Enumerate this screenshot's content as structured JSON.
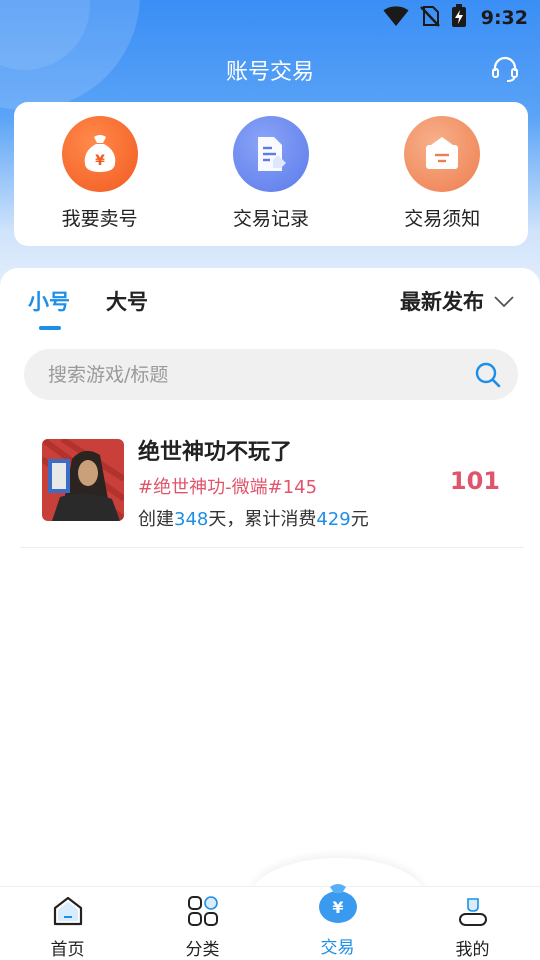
{
  "status_bar": {
    "time": "9:32"
  },
  "header": {
    "title": "账号交易"
  },
  "quick_actions": [
    {
      "label": "我要卖号",
      "icon": "money-bag-icon",
      "color": "#f5682f"
    },
    {
      "label": "交易记录",
      "icon": "document-edit-icon",
      "color": "#5b7bea"
    },
    {
      "label": "交易须知",
      "icon": "briefcase-icon",
      "color": "#f08a5d"
    }
  ],
  "tabs": [
    {
      "label": "小号",
      "active": true
    },
    {
      "label": "大号",
      "active": false
    }
  ],
  "sort": {
    "label": "最新发布"
  },
  "search": {
    "placeholder": "搜索游戏/标题"
  },
  "listings": [
    {
      "title": "绝世神功不玩了",
      "tag": "#绝世神功-微端#145",
      "stats_prefix": "创建",
      "days": "348",
      "stats_mid": "天，累计消费",
      "spent": "429",
      "stats_suffix": "元",
      "price": "101"
    }
  ],
  "bottom_nav": [
    {
      "label": "首页",
      "icon": "home-icon",
      "active": false
    },
    {
      "label": "分类",
      "icon": "category-grid-icon",
      "active": false
    },
    {
      "label": "交易",
      "icon": "trade-bag-icon",
      "active": true
    },
    {
      "label": "我的",
      "icon": "profile-icon",
      "active": false
    }
  ],
  "colors": {
    "accent": "#1d8fe6",
    "price": "#e0556b"
  }
}
